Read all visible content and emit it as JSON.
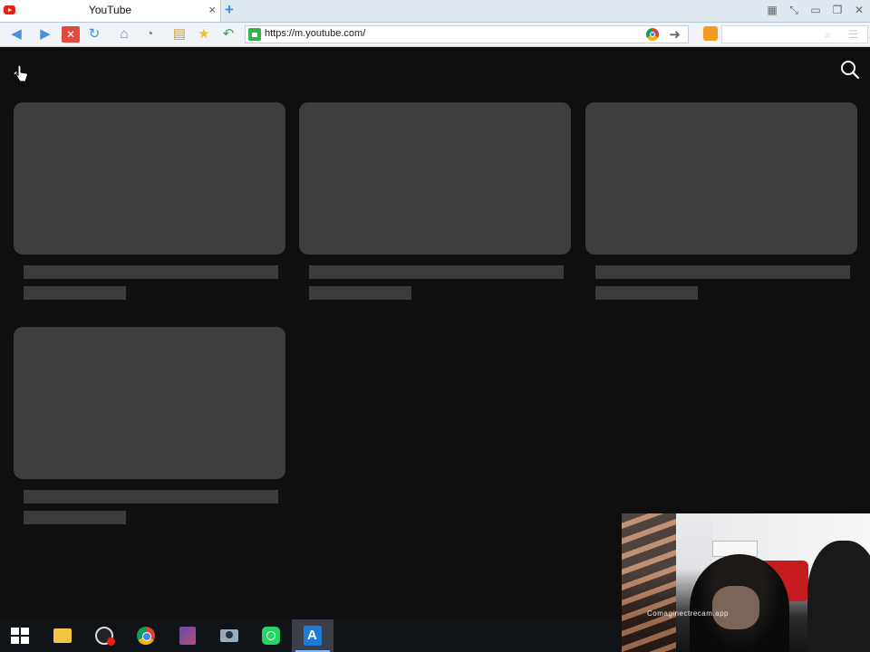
{
  "browser": {
    "tab_title": "YouTube",
    "tab_close": "×",
    "new_tab": "+",
    "url": "https://m.youtube.com/"
  },
  "page": {
    "back_icon": "arrow-left-icon",
    "search_icon": "search-icon",
    "card_count": 4
  },
  "webcam": {
    "watermark": "Comaginectrecam.app"
  },
  "taskbar": {
    "apps": [
      "start-icon",
      "file-explorer-icon",
      "speedometer-icon",
      "chrome-icon",
      "app-icon",
      "camera-icon",
      "whatsapp-icon",
      "arrow-app-icon"
    ],
    "active": "arrow-app-icon"
  },
  "colors": {
    "page_bg": "#0f0f0f",
    "placeholder": "#3e3e3e",
    "tab_bar": "#dfe7f1"
  }
}
